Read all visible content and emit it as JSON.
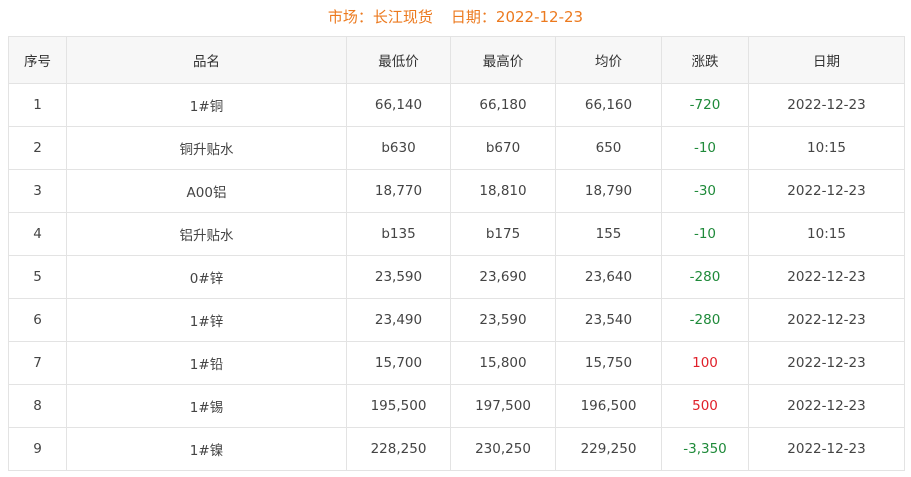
{
  "header": {
    "market_label": "市场：",
    "market_value": "长江现货",
    "date_label": "日期：",
    "date_value": "2022-12-23"
  },
  "colors": {
    "title": "#ec7a1f",
    "down": "#1f8a3a",
    "up": "#e0202a",
    "header_bg": "#f7f7f7",
    "border": "#e3e3e3"
  },
  "table": {
    "columns": [
      "序号",
      "品名",
      "最低价",
      "最高价",
      "均价",
      "涨跌",
      "日期"
    ],
    "rows": [
      {
        "no": "1",
        "name": "1#铜",
        "low": "66,140",
        "high": "66,180",
        "avg": "66,160",
        "change": "-720",
        "trend": "down",
        "date": "2022-12-23"
      },
      {
        "no": "2",
        "name": "铜升贴水",
        "low": "b630",
        "high": "b670",
        "avg": "650",
        "change": "-10",
        "trend": "down",
        "date": "10:15"
      },
      {
        "no": "3",
        "name": "A00铝",
        "low": "18,770",
        "high": "18,810",
        "avg": "18,790",
        "change": "-30",
        "trend": "down",
        "date": "2022-12-23"
      },
      {
        "no": "4",
        "name": "铝升贴水",
        "low": "b135",
        "high": "b175",
        "avg": "155",
        "change": "-10",
        "trend": "down",
        "date": "10:15"
      },
      {
        "no": "5",
        "name": "0#锌",
        "low": "23,590",
        "high": "23,690",
        "avg": "23,640",
        "change": "-280",
        "trend": "down",
        "date": "2022-12-23"
      },
      {
        "no": "6",
        "name": "1#锌",
        "low": "23,490",
        "high": "23,590",
        "avg": "23,540",
        "change": "-280",
        "trend": "down",
        "date": "2022-12-23"
      },
      {
        "no": "7",
        "name": "1#铅",
        "low": "15,700",
        "high": "15,800",
        "avg": "15,750",
        "change": "100",
        "trend": "up",
        "date": "2022-12-23"
      },
      {
        "no": "8",
        "name": "1#锡",
        "low": "195,500",
        "high": "197,500",
        "avg": "196,500",
        "change": "500",
        "trend": "up",
        "date": "2022-12-23"
      },
      {
        "no": "9",
        "name": "1#镍",
        "low": "228,250",
        "high": "230,250",
        "avg": "229,250",
        "change": "-3,350",
        "trend": "down",
        "date": "2022-12-23"
      }
    ]
  }
}
